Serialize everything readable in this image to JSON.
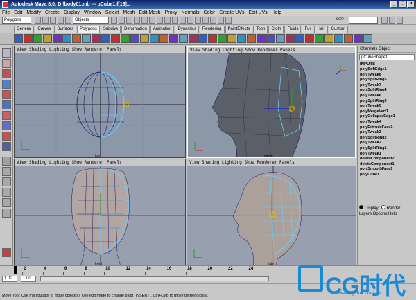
{
  "window": {
    "title": "Autodesk Maya 8.0: D:\\body01.mb  ---  pCube1.f[16]..."
  },
  "menu": [
    "File",
    "Edit",
    "Modify",
    "Create",
    "Display",
    "Window",
    "Select",
    "Mesh",
    "Edit Mesh",
    "Proxy",
    "Normals",
    "Color",
    "Create UVs",
    "Edit UVs",
    "Help"
  ],
  "status_line": {
    "mode": "Polygons",
    "object_field": "Objects",
    "sel_label": "sel>"
  },
  "shelf_tabs": [
    "General",
    "Curves",
    "Surfaces",
    "Polygons",
    "Subdivs",
    "Deformation",
    "Animation",
    "Dynamics",
    "Rendering",
    "PaintEffects",
    "Toon",
    "Cloth",
    "Fluids",
    "Fur",
    "Hair",
    "Custom"
  ],
  "shelf_active_tab": "Polygons",
  "panel_menu": "View  Shading  Lighting  Show  Renderer  Panels",
  "viewports": [
    {
      "label": "top",
      "active": false
    },
    {
      "label": "persp",
      "active": true
    },
    {
      "label": "front",
      "active": false
    },
    {
      "label": "side",
      "active": false
    }
  ],
  "channel_box": {
    "header": "Channels  Object",
    "object_name": "pCubeShape1",
    "inputs_label": "INPUTS",
    "inputs": [
      "polySoftEdge1",
      "polyTweak8",
      "polySplitRing5",
      "polyTweak7",
      "polySplitRing4",
      "polyTweak6",
      "polySplitRing3",
      "polyTweak5",
      "polyMergeVert1",
      "polyCollapseEdge1",
      "polyTweak4",
      "polyExtrudeFace1",
      "polyTweak3",
      "polySplitRing2",
      "polyTweak2",
      "polySplitRing1",
      "polyTweak1",
      "deleteComponent2",
      "deleteComponent1",
      "polySmoothFace1",
      "polyCube1"
    ]
  },
  "layer_editor": {
    "display_label": "Display",
    "render_label": "Render",
    "menu": "Layers  Options  Help"
  },
  "timeline": {
    "ticks": [
      "2",
      "4",
      "6",
      "8",
      "10",
      "12",
      "14",
      "16",
      "18",
      "20",
      "22",
      "24"
    ],
    "start": "1.00",
    "end": "1.00"
  },
  "help_line": "Move Tool: Use manipulator to move object(s). Use edit mode to change pivot (INSERT). Ctrl+LMB to move perpendicular.",
  "watermark": {
    "logo_text": "CG时代",
    "url": "www.cgtime.com.cn"
  },
  "colors": {
    "viewport_bg": "#8c97a8",
    "wireframe_selected": "#6ad0ff",
    "wireframe": "#1a1a6a",
    "logo": "#1a8ad6"
  }
}
